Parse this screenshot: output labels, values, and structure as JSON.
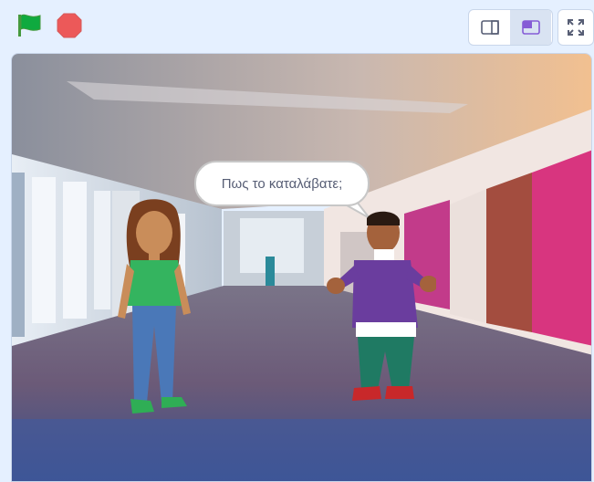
{
  "toolbar": {
    "green_flag_icon": "green-flag-icon",
    "stop_icon": "stop-sign-icon",
    "small_stage_icon": "small-stage-icon",
    "normal_stage_icon": "normal-stage-icon",
    "fullscreen_icon": "fullscreen-icon",
    "active_layout": "normal"
  },
  "stage": {
    "backdrop": "hallway",
    "speech_bubble_text": "Πως το καταλάβατε;",
    "sprites": [
      "girl",
      "boy"
    ]
  },
  "colors": {
    "flag": "#0faa3f",
    "stop": "#ec5959",
    "ui_background": "#e5f0ff",
    "accent": "#855cd6"
  }
}
